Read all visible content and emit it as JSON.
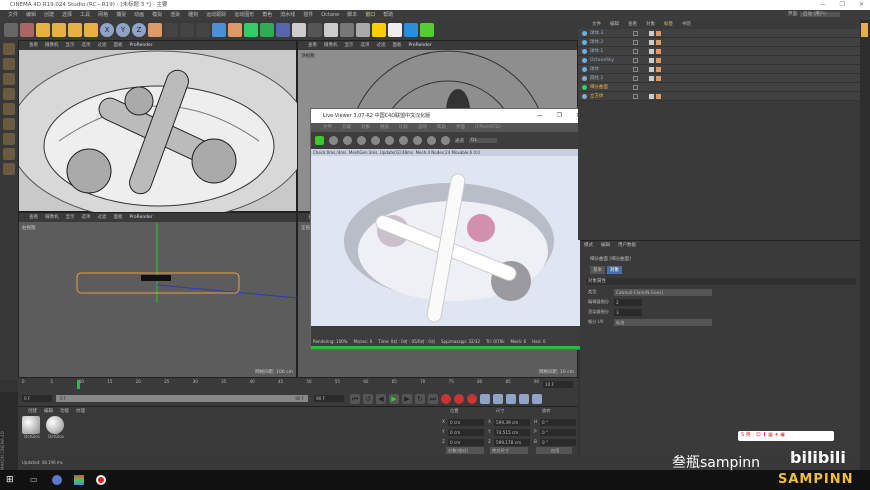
{
  "window": {
    "title": "CINEMA 4D R19.024 Studio (RC - R19) - [未标题 3 *] - 主要",
    "controls": [
      "—",
      "❐",
      "✕"
    ]
  },
  "menu": [
    "文件",
    "编辑",
    "创建",
    "选择",
    "工具",
    "网格",
    "捕捉",
    "动画",
    "模拟",
    "渲染",
    "雕刻",
    "运动跟踪",
    "运动图形",
    "角色",
    "流水线",
    "插件",
    "Octane",
    "脚本",
    "窗口",
    "帮助"
  ],
  "menu_highlight": [
    "窗口"
  ],
  "toolbar": {
    "icons": [
      "undo",
      "live-select",
      "move",
      "scale",
      "rotate",
      "add",
      "x-axis",
      "y-axis",
      "z-axis",
      "coord-system",
      "render-view",
      "render",
      "render-settings",
      "cube",
      "pen",
      "subdivide",
      "array",
      "deformer",
      "floor",
      "camera",
      "light",
      "octane-material",
      "octane-sky",
      "octane-light",
      "octane-camera",
      "octane-settings",
      "octane-live"
    ],
    "axis_labels": [
      "X",
      "Y",
      "Z"
    ]
  },
  "viewports": [
    {
      "menu": [
        "查看",
        "摄像机",
        "显示",
        "选项",
        "过滤",
        "面板",
        "ProRender"
      ],
      "label": ""
    },
    {
      "menu": [
        "查看",
        "摄像机",
        "显示",
        "选项",
        "过滤",
        "面板",
        "ProRender"
      ],
      "label": "顶视图"
    },
    {
      "menu": [
        "查看",
        "摄像机",
        "显示",
        "选项",
        "过滤",
        "面板",
        "ProRender"
      ],
      "label": "右视图",
      "grid": "网格间距: 100 cm"
    },
    {
      "menu": [
        "查看",
        "摄像机",
        "显示",
        "选项",
        "过滤",
        "面板",
        "ProRender"
      ],
      "label": "正视图",
      "grid": "网格间距: 10 cm"
    }
  ],
  "live_viewer": {
    "title": "Live Viewer 3.07-R2 中国C4D联盟中文汉化版",
    "menu": [
      "文件",
      "云端",
      "对象",
      "材质",
      "比较",
      "选项",
      "帮助",
      "界面",
      "[FPS/HSTD]"
    ],
    "channel_label": "通道",
    "channel_value": "DL",
    "info": "Check:0ms./4ms. MeshGen:3ms. Update[G]:48ms. Mesh:4 Nodes:24 Movable:6  0:0",
    "status": [
      "Rendering: 100%",
      "Ms/sec: 0",
      "Time: 0对 : 0对 : 05/0对 : 0对",
      "Spp/maxspp: 32/32",
      "Tri: 0/70k",
      "Mesh: 6",
      "Hair: 0"
    ],
    "progress": 1.0
  },
  "object_manager": {
    "menu": [
      "文件",
      "编辑",
      "查看",
      "对象",
      "标签",
      "书签"
    ],
    "objects": [
      {
        "name": "球体.3",
        "icon": "sphere"
      },
      {
        "name": "球体.2",
        "icon": "sphere"
      },
      {
        "name": "球体.1",
        "icon": "sphere"
      },
      {
        "name": "OctaneSky",
        "icon": "sky"
      },
      {
        "name": "球体",
        "icon": "sphere"
      },
      {
        "name": "圆柱.2",
        "icon": "null"
      },
      {
        "name": "细分曲面",
        "icon": "subdivision",
        "selected": true
      },
      {
        "name": "立方体",
        "icon": "null",
        "selected": true
      }
    ]
  },
  "attributes": {
    "menu": [
      "模式",
      "编辑",
      "用户数据"
    ],
    "object_title": "细分曲面 [细分曲面]",
    "tabs": [
      "基本",
      "对象"
    ],
    "section": "对象属性",
    "fields": [
      {
        "label": "类型",
        "value": "Catmull-Clark(N-Gons)"
      },
      {
        "label": "编辑器细分",
        "value": "2"
      },
      {
        "label": "渲染器细分",
        "value": "3"
      },
      {
        "label": "细分 UV",
        "value": "标准"
      }
    ]
  },
  "timeline": {
    "ticks": [
      "0",
      "5",
      "10",
      "15",
      "20",
      "25",
      "30",
      "35",
      "40",
      "45",
      "50",
      "55",
      "60",
      "65",
      "70",
      "75",
      "80",
      "85",
      "90"
    ],
    "current_frame": 10,
    "end_field": "10 F",
    "start": "0 F",
    "range_start": "0 F",
    "range_end": "90 F",
    "max": "90 F"
  },
  "materials": {
    "menu": [
      "创建",
      "编辑",
      "功能",
      "纹理"
    ],
    "items": [
      "OctGlos",
      "OctGlos"
    ]
  },
  "coordinates": {
    "headers": [
      "位置",
      "尺寸",
      "旋转"
    ],
    "rows": [
      [
        "X",
        "0 cm",
        "X",
        "599.39 cm",
        "H",
        "0 °"
      ],
      [
        "Y",
        "0 cm",
        "Y",
        "74.515 cm",
        "P",
        "0 °"
      ],
      [
        "Z",
        "0 cm",
        "Z",
        "599.178 cm",
        "B",
        "0 °"
      ]
    ],
    "dropdowns": [
      "对象(相对)",
      "绝对尺寸"
    ],
    "apply": "应用"
  },
  "status": "Updated: 48.196 ms",
  "layout": {
    "label": "界面:",
    "value": "启动 (用户)"
  },
  "watermark": {
    "text": "叁瓶sampinn",
    "logo": "bilibili",
    "brand": "SAMPINN"
  },
  "colors": {
    "accent": "#e0d070",
    "progress": "#2db84d",
    "selected": "#e8b040"
  }
}
